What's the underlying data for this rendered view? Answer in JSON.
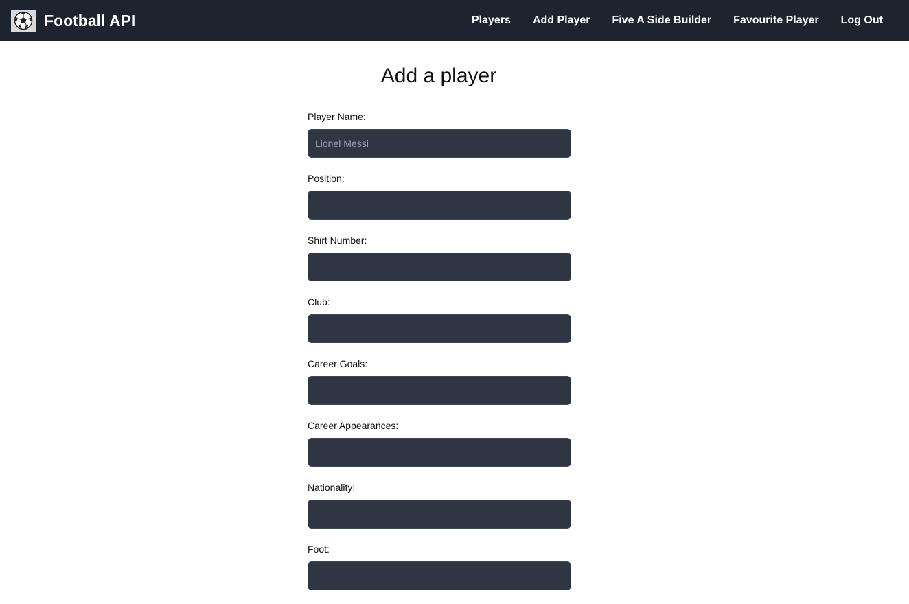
{
  "navbar": {
    "logo_icon": "soccer-ball-icon",
    "brand": "Football API",
    "links": [
      {
        "label": "Players"
      },
      {
        "label": "Add Player"
      },
      {
        "label": "Five A Side Builder"
      },
      {
        "label": "Favourite Player"
      },
      {
        "label": "Log Out"
      }
    ]
  },
  "main": {
    "title": "Add a player",
    "fields": [
      {
        "label": "Player Name:",
        "placeholder": "Lionel Messi",
        "value": ""
      },
      {
        "label": "Position:",
        "placeholder": "",
        "value": ""
      },
      {
        "label": "Shirt Number:",
        "placeholder": "",
        "value": ""
      },
      {
        "label": "Club:",
        "placeholder": "",
        "value": ""
      },
      {
        "label": "Career Goals:",
        "placeholder": "",
        "value": ""
      },
      {
        "label": "Career Appearances:",
        "placeholder": "",
        "value": ""
      },
      {
        "label": "Nationality:",
        "placeholder": "",
        "value": ""
      },
      {
        "label": "Foot:",
        "placeholder": "",
        "value": ""
      }
    ]
  },
  "colors": {
    "navbar_bg": "#1d2430",
    "input_bg": "#2e3643",
    "text_primary": "#111111"
  }
}
